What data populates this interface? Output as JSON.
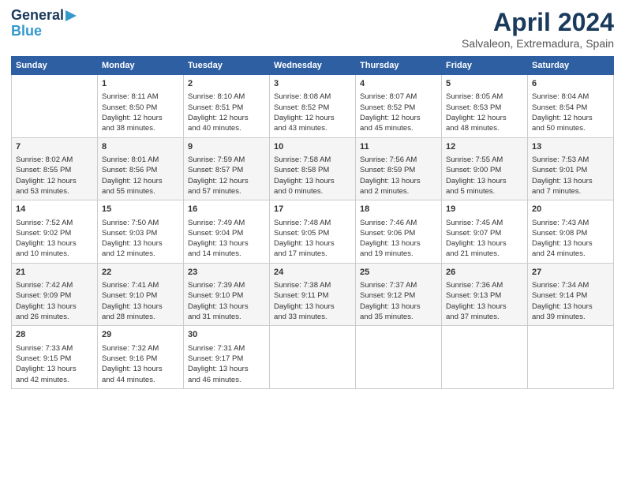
{
  "header": {
    "logo_line1": "General",
    "logo_line2": "Blue",
    "title": "April 2024",
    "subtitle": "Salvaleon, Extremadura, Spain"
  },
  "weekdays": [
    "Sunday",
    "Monday",
    "Tuesday",
    "Wednesday",
    "Thursday",
    "Friday",
    "Saturday"
  ],
  "weeks": [
    [
      {
        "day": "",
        "text": ""
      },
      {
        "day": "1",
        "text": "Sunrise: 8:11 AM\nSunset: 8:50 PM\nDaylight: 12 hours\nand 38 minutes."
      },
      {
        "day": "2",
        "text": "Sunrise: 8:10 AM\nSunset: 8:51 PM\nDaylight: 12 hours\nand 40 minutes."
      },
      {
        "day": "3",
        "text": "Sunrise: 8:08 AM\nSunset: 8:52 PM\nDaylight: 12 hours\nand 43 minutes."
      },
      {
        "day": "4",
        "text": "Sunrise: 8:07 AM\nSunset: 8:52 PM\nDaylight: 12 hours\nand 45 minutes."
      },
      {
        "day": "5",
        "text": "Sunrise: 8:05 AM\nSunset: 8:53 PM\nDaylight: 12 hours\nand 48 minutes."
      },
      {
        "day": "6",
        "text": "Sunrise: 8:04 AM\nSunset: 8:54 PM\nDaylight: 12 hours\nand 50 minutes."
      }
    ],
    [
      {
        "day": "7",
        "text": "Sunrise: 8:02 AM\nSunset: 8:55 PM\nDaylight: 12 hours\nand 53 minutes."
      },
      {
        "day": "8",
        "text": "Sunrise: 8:01 AM\nSunset: 8:56 PM\nDaylight: 12 hours\nand 55 minutes."
      },
      {
        "day": "9",
        "text": "Sunrise: 7:59 AM\nSunset: 8:57 PM\nDaylight: 12 hours\nand 57 minutes."
      },
      {
        "day": "10",
        "text": "Sunrise: 7:58 AM\nSunset: 8:58 PM\nDaylight: 13 hours\nand 0 minutes."
      },
      {
        "day": "11",
        "text": "Sunrise: 7:56 AM\nSunset: 8:59 PM\nDaylight: 13 hours\nand 2 minutes."
      },
      {
        "day": "12",
        "text": "Sunrise: 7:55 AM\nSunset: 9:00 PM\nDaylight: 13 hours\nand 5 minutes."
      },
      {
        "day": "13",
        "text": "Sunrise: 7:53 AM\nSunset: 9:01 PM\nDaylight: 13 hours\nand 7 minutes."
      }
    ],
    [
      {
        "day": "14",
        "text": "Sunrise: 7:52 AM\nSunset: 9:02 PM\nDaylight: 13 hours\nand 10 minutes."
      },
      {
        "day": "15",
        "text": "Sunrise: 7:50 AM\nSunset: 9:03 PM\nDaylight: 13 hours\nand 12 minutes."
      },
      {
        "day": "16",
        "text": "Sunrise: 7:49 AM\nSunset: 9:04 PM\nDaylight: 13 hours\nand 14 minutes."
      },
      {
        "day": "17",
        "text": "Sunrise: 7:48 AM\nSunset: 9:05 PM\nDaylight: 13 hours\nand 17 minutes."
      },
      {
        "day": "18",
        "text": "Sunrise: 7:46 AM\nSunset: 9:06 PM\nDaylight: 13 hours\nand 19 minutes."
      },
      {
        "day": "19",
        "text": "Sunrise: 7:45 AM\nSunset: 9:07 PM\nDaylight: 13 hours\nand 21 minutes."
      },
      {
        "day": "20",
        "text": "Sunrise: 7:43 AM\nSunset: 9:08 PM\nDaylight: 13 hours\nand 24 minutes."
      }
    ],
    [
      {
        "day": "21",
        "text": "Sunrise: 7:42 AM\nSunset: 9:09 PM\nDaylight: 13 hours\nand 26 minutes."
      },
      {
        "day": "22",
        "text": "Sunrise: 7:41 AM\nSunset: 9:10 PM\nDaylight: 13 hours\nand 28 minutes."
      },
      {
        "day": "23",
        "text": "Sunrise: 7:39 AM\nSunset: 9:10 PM\nDaylight: 13 hours\nand 31 minutes."
      },
      {
        "day": "24",
        "text": "Sunrise: 7:38 AM\nSunset: 9:11 PM\nDaylight: 13 hours\nand 33 minutes."
      },
      {
        "day": "25",
        "text": "Sunrise: 7:37 AM\nSunset: 9:12 PM\nDaylight: 13 hours\nand 35 minutes."
      },
      {
        "day": "26",
        "text": "Sunrise: 7:36 AM\nSunset: 9:13 PM\nDaylight: 13 hours\nand 37 minutes."
      },
      {
        "day": "27",
        "text": "Sunrise: 7:34 AM\nSunset: 9:14 PM\nDaylight: 13 hours\nand 39 minutes."
      }
    ],
    [
      {
        "day": "28",
        "text": "Sunrise: 7:33 AM\nSunset: 9:15 PM\nDaylight: 13 hours\nand 42 minutes."
      },
      {
        "day": "29",
        "text": "Sunrise: 7:32 AM\nSunset: 9:16 PM\nDaylight: 13 hours\nand 44 minutes."
      },
      {
        "day": "30",
        "text": "Sunrise: 7:31 AM\nSunset: 9:17 PM\nDaylight: 13 hours\nand 46 minutes."
      },
      {
        "day": "",
        "text": ""
      },
      {
        "day": "",
        "text": ""
      },
      {
        "day": "",
        "text": ""
      },
      {
        "day": "",
        "text": ""
      }
    ]
  ]
}
